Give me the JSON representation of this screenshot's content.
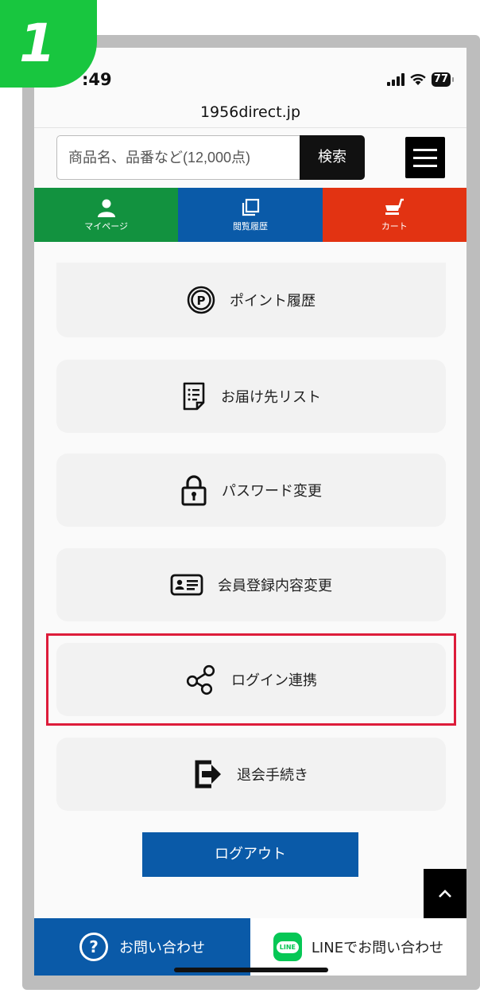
{
  "step_badge": "1",
  "statusbar": {
    "time": ":49",
    "battery": "77"
  },
  "url": "1956direct.jp",
  "search": {
    "placeholder": "商品名、品番など(12,000点)",
    "button_label": "検索"
  },
  "nav": {
    "items": [
      {
        "label": "マイページ",
        "icon": "person-icon",
        "color": "#12923f"
      },
      {
        "label": "閲覧履歴",
        "icon": "history-icon",
        "color": "#0a5aa8"
      },
      {
        "label": "カート",
        "icon": "cart-icon",
        "color": "#e23312"
      }
    ]
  },
  "menu_items": [
    {
      "label": "ポイント履歴",
      "icon": "point-icon"
    },
    {
      "label": "お届け先リスト",
      "icon": "list-document-icon"
    },
    {
      "label": "パスワード変更",
      "icon": "lock-icon"
    },
    {
      "label": "会員登録内容変更",
      "icon": "id-card-icon"
    },
    {
      "label": "ログイン連携",
      "icon": "share-icon",
      "highlighted": true
    },
    {
      "label": "退会手続き",
      "icon": "exit-icon"
    }
  ],
  "logout_label": "ログアウト",
  "bottom": {
    "contact_label": "お問い合わせ",
    "line_label": "LINEでお問い合わせ",
    "line_badge": "LINE"
  },
  "colors": {
    "highlight": "#dd1c3a",
    "accent_blue": "#0a5aa8",
    "badge_green": "#18c63f"
  }
}
